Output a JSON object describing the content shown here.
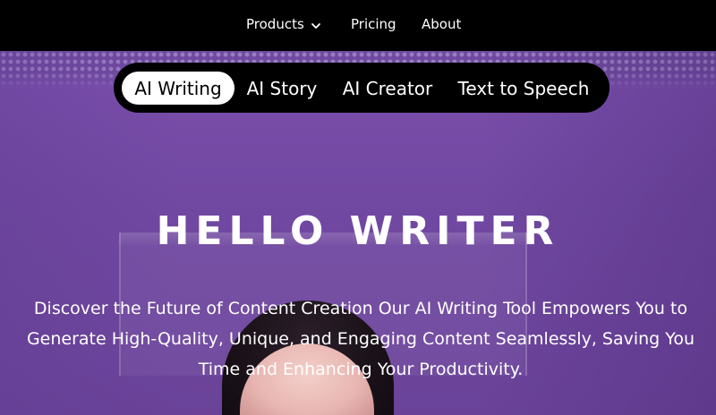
{
  "nav": {
    "items": [
      {
        "label": "Products",
        "has_dropdown": true
      },
      {
        "label": "Pricing"
      },
      {
        "label": "About"
      }
    ]
  },
  "tabs": {
    "items": [
      {
        "label": "AI Writing",
        "active": true
      },
      {
        "label": "AI Story",
        "active": false
      },
      {
        "label": "AI Creator",
        "active": false
      },
      {
        "label": "Text to Speech",
        "active": false
      }
    ]
  },
  "hero": {
    "title": "HELLO WRITER",
    "description": "Discover the Future of Content Creation Our AI Writing Tool Empowers You to Generate High-Quality, Unique, and Engaging Content Seamlessly, Saving You Time and Enhancing Your Productivity."
  },
  "colors": {
    "nav_bg": "#000000",
    "hero_bg": "#7a4fac",
    "text": "#ffffff",
    "tab_active_bg": "#ffffff",
    "tab_active_text": "#000000"
  }
}
